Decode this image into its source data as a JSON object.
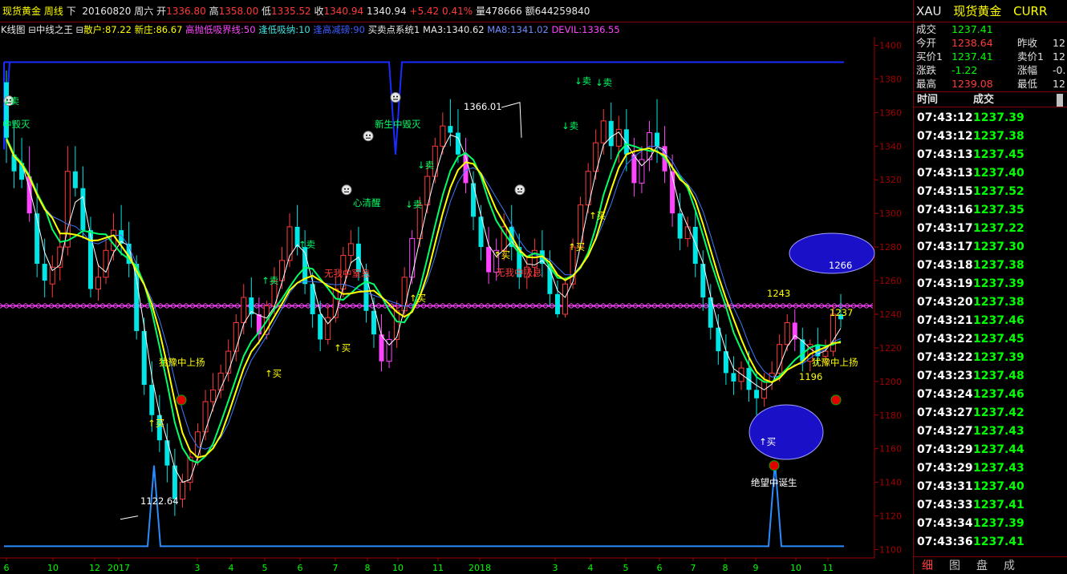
{
  "header": {
    "instrument": "现货黄金",
    "period": "周线",
    "direction": "下",
    "date": "20160820",
    "weekday": "周六",
    "open_label": "开",
    "open": "1336.80",
    "high_label": "高",
    "high": "1358.00",
    "low_label": "低",
    "low": "1335.52",
    "close_label": "收",
    "close": "1340.94",
    "last": "1340.94",
    "change": "+5.42",
    "change_pct": "0.41%",
    "volume_label": "量",
    "volume": "478666",
    "amount_label": "额",
    "amount": "644259840"
  },
  "indicator_bar": {
    "chart_mode": "K线图",
    "ind1": "中线之王",
    "sanhu": "散户:87.22",
    "xinzhuang": "新庄:86.67",
    "gaopao": "高抛低吸界线:50",
    "fengdi": "逢低吸纳:10",
    "fenggao": "逢高减磅:90",
    "ind2": "买卖点系统1",
    "ma3": "MA3:1340.62",
    "ma8": "MA8:1341.02",
    "devil": "DEVIL:1336.55"
  },
  "right_panel": {
    "symbol": "XAU",
    "name": "现货黄金",
    "market": "CURR",
    "quotes": [
      {
        "label": "成交",
        "value": "1237.41",
        "color": "#00ff00"
      },
      {
        "label": "今开",
        "value": "1238.64",
        "color": "#ff3b3b"
      },
      {
        "label": "买价1",
        "value": "1237.41",
        "color": "#00ff00"
      },
      {
        "label": "涨跌",
        "value": "-1.22",
        "color": "#00ff00"
      },
      {
        "label": "最高",
        "value": "1239.08",
        "color": "#ff3b3b"
      }
    ],
    "quotes_right": [
      {
        "label": "昨收",
        "value": "12"
      },
      {
        "label": "卖价1",
        "value": "12"
      },
      {
        "label": "涨幅",
        "value": "-0."
      },
      {
        "label": "最低",
        "value": "12"
      }
    ],
    "trade_header_time": "时间",
    "trade_header_price": "成交",
    "trades": [
      {
        "time": "07:43:12",
        "price": "1237.39"
      },
      {
        "time": "07:43:12",
        "price": "1237.38"
      },
      {
        "time": "07:43:13",
        "price": "1237.45"
      },
      {
        "time": "07:43:13",
        "price": "1237.40"
      },
      {
        "time": "07:43:15",
        "price": "1237.52"
      },
      {
        "time": "07:43:16",
        "price": "1237.35"
      },
      {
        "time": "07:43:17",
        "price": "1237.22"
      },
      {
        "time": "07:43:17",
        "price": "1237.30"
      },
      {
        "time": "07:43:18",
        "price": "1237.38"
      },
      {
        "time": "07:43:19",
        "price": "1237.39"
      },
      {
        "time": "07:43:20",
        "price": "1237.38"
      },
      {
        "time": "07:43:21",
        "price": "1237.46"
      },
      {
        "time": "07:43:22",
        "price": "1237.45"
      },
      {
        "time": "07:43:22",
        "price": "1237.39"
      },
      {
        "time": "07:43:23",
        "price": "1237.48"
      },
      {
        "time": "07:43:24",
        "price": "1237.46"
      },
      {
        "time": "07:43:27",
        "price": "1237.42"
      },
      {
        "time": "07:43:27",
        "price": "1237.43"
      },
      {
        "time": "07:43:29",
        "price": "1237.44"
      },
      {
        "time": "07:43:29",
        "price": "1237.43"
      },
      {
        "time": "07:43:31",
        "price": "1237.40"
      },
      {
        "time": "07:43:33",
        "price": "1237.41"
      },
      {
        "time": "07:43:34",
        "price": "1237.39"
      },
      {
        "time": "07:43:36",
        "price": "1237.41"
      }
    ],
    "tabs": [
      "细",
      "图",
      "盘",
      "成"
    ]
  },
  "chart_data": {
    "type": "candlestick",
    "ylim": [
      1095,
      1405
    ],
    "y_ticks": [
      1100,
      1120,
      1140,
      1160,
      1180,
      1200,
      1220,
      1240,
      1260,
      1280,
      1300,
      1320,
      1340,
      1360,
      1380,
      1400
    ],
    "x_ticks": [
      "6",
      "10",
      "12",
      "2017",
      "3",
      "4",
      "5",
      "6",
      "7",
      "8",
      "10",
      "11",
      "2018",
      "3",
      "4",
      "5",
      "6",
      "7",
      "8",
      "9",
      "10",
      "11"
    ],
    "reference_line": 1245,
    "colors": {
      "up": "#ff3b3b",
      "down": "#00e5e5",
      "special_down": "#ff44ff",
      "yellow": "#ffff00",
      "green": "#00ff66",
      "ma_white": "#ffffff",
      "ma_blue": "#3b7bff",
      "step": "#1a2cff",
      "bottom": "#2a8cff",
      "ref": "#ff44ff"
    },
    "key_prices": [
      {
        "text": "1122.64",
        "price": 1122.64
      },
      {
        "text": "1366.01",
        "price": 1366.01
      },
      {
        "text": "1243",
        "price": 1243
      },
      {
        "text": "1196",
        "price": 1196
      },
      {
        "text": "1237",
        "price": 1237
      },
      {
        "text": "1266",
        "price": 1266
      }
    ],
    "signals": [
      {
        "text": "↓卖"
      },
      {
        "text": "中毁灭"
      },
      {
        "text": "↑买"
      },
      {
        "text": "犹豫中上扬"
      },
      {
        "text": "↑买"
      },
      {
        "text": "↑卖"
      },
      {
        "text": "无我中窒息"
      },
      {
        "text": "↑买"
      },
      {
        "text": "↑卖"
      },
      {
        "text": "心清醒"
      },
      {
        "text": "↓卖"
      },
      {
        "text": "新生中毁灭"
      },
      {
        "text": "↓卖"
      },
      {
        "text": "↑买"
      },
      {
        "text": "无我中吸息"
      },
      {
        "text": "↑买"
      },
      {
        "text": "↓卖"
      },
      {
        "text": "↓卖"
      },
      {
        "text": "↓卖"
      },
      {
        "text": "↑买"
      },
      {
        "text": "↑买"
      },
      {
        "text": "↑买"
      },
      {
        "text": "绝望中诞生"
      },
      {
        "text": "犹豫中上扬"
      }
    ],
    "candles": [
      [
        1378,
        1385,
        1345,
        1330
      ],
      [
        1335,
        1355,
        1325,
        1315
      ],
      [
        1330,
        1345,
        1320,
        1315
      ],
      [
        1322,
        1340,
        1300,
        1295
      ],
      [
        1300,
        1318,
        1270,
        1262
      ],
      [
        1270,
        1285,
        1260,
        1250
      ],
      [
        1258,
        1275,
        1268,
        1250
      ],
      [
        1268,
        1290,
        1280,
        1260
      ],
      [
        1280,
        1340,
        1325,
        1275
      ],
      [
        1325,
        1340,
        1315,
        1310
      ],
      [
        1315,
        1328,
        1290,
        1285
      ],
      [
        1290,
        1298,
        1255,
        1250
      ],
      [
        1255,
        1270,
        1262,
        1248
      ],
      [
        1262,
        1285,
        1278,
        1258
      ],
      [
        1278,
        1300,
        1290,
        1272
      ],
      [
        1290,
        1305,
        1282,
        1275
      ],
      [
        1282,
        1295,
        1270,
        1262
      ],
      [
        1270,
        1275,
        1230,
        1225
      ],
      [
        1230,
        1238,
        1198,
        1192
      ],
      [
        1198,
        1212,
        1180,
        1170
      ],
      [
        1180,
        1192,
        1165,
        1158
      ],
      [
        1165,
        1175,
        1150,
        1140
      ],
      [
        1150,
        1160,
        1130,
        1120
      ],
      [
        1130,
        1145,
        1140,
        1125
      ],
      [
        1140,
        1160,
        1155,
        1135
      ],
      [
        1155,
        1175,
        1170,
        1150
      ],
      [
        1170,
        1195,
        1188,
        1165
      ],
      [
        1188,
        1205,
        1195,
        1182
      ],
      [
        1195,
        1210,
        1205,
        1190
      ],
      [
        1205,
        1225,
        1218,
        1200
      ],
      [
        1218,
        1240,
        1235,
        1212
      ],
      [
        1235,
        1258,
        1250,
        1228
      ],
      [
        1250,
        1262,
        1240,
        1232
      ],
      [
        1240,
        1250,
        1228,
        1222
      ],
      [
        1228,
        1248,
        1245,
        1225
      ],
      [
        1245,
        1268,
        1260,
        1240
      ],
      [
        1260,
        1280,
        1272,
        1255
      ],
      [
        1272,
        1300,
        1292,
        1268
      ],
      [
        1292,
        1305,
        1280,
        1275
      ],
      [
        1280,
        1290,
        1258,
        1252
      ],
      [
        1258,
        1265,
        1240,
        1232
      ],
      [
        1240,
        1248,
        1225,
        1218
      ],
      [
        1225,
        1245,
        1238,
        1222
      ],
      [
        1238,
        1262,
        1255,
        1235
      ],
      [
        1255,
        1280,
        1275,
        1250
      ],
      [
        1275,
        1290,
        1282,
        1270
      ],
      [
        1282,
        1292,
        1265,
        1260
      ],
      [
        1265,
        1270,
        1242,
        1235
      ],
      [
        1242,
        1250,
        1228,
        1220
      ],
      [
        1228,
        1240,
        1212,
        1206
      ],
      [
        1212,
        1230,
        1225,
        1208
      ],
      [
        1225,
        1248,
        1242,
        1220
      ],
      [
        1242,
        1268,
        1262,
        1238
      ],
      [
        1262,
        1290,
        1285,
        1258
      ],
      [
        1285,
        1310,
        1305,
        1280
      ],
      [
        1305,
        1330,
        1322,
        1300
      ],
      [
        1322,
        1345,
        1340,
        1318
      ],
      [
        1340,
        1360,
        1352,
        1335
      ],
      [
        1352,
        1368,
        1348,
        1340
      ],
      [
        1348,
        1362,
        1335,
        1330
      ],
      [
        1335,
        1345,
        1318,
        1312
      ],
      [
        1318,
        1325,
        1298,
        1290
      ],
      [
        1298,
        1305,
        1280,
        1272
      ],
      [
        1280,
        1292,
        1265,
        1258
      ],
      [
        1265,
        1285,
        1278,
        1260
      ],
      [
        1278,
        1300,
        1292,
        1272
      ],
      [
        1292,
        1305,
        1280,
        1272
      ],
      [
        1280,
        1288,
        1262,
        1255
      ],
      [
        1262,
        1275,
        1268,
        1255
      ],
      [
        1268,
        1285,
        1278,
        1262
      ],
      [
        1278,
        1290,
        1270,
        1262
      ],
      [
        1270,
        1278,
        1252,
        1245
      ],
      [
        1252,
        1260,
        1240,
        1238
      ],
      [
        1240,
        1262,
        1258,
        1238
      ],
      [
        1258,
        1285,
        1280,
        1255
      ],
      [
        1280,
        1310,
        1305,
        1278
      ],
      [
        1305,
        1330,
        1325,
        1300
      ],
      [
        1325,
        1350,
        1342,
        1320
      ],
      [
        1342,
        1362,
        1355,
        1335
      ],
      [
        1355,
        1366,
        1340,
        1332
      ],
      [
        1340,
        1358,
        1350,
        1330
      ],
      [
        1350,
        1362,
        1335,
        1325
      ],
      [
        1335,
        1345,
        1318,
        1310
      ],
      [
        1318,
        1340,
        1332,
        1312
      ],
      [
        1332,
        1355,
        1348,
        1325
      ],
      [
        1348,
        1368,
        1340,
        1330
      ],
      [
        1340,
        1352,
        1325,
        1318
      ],
      [
        1325,
        1335,
        1300,
        1292
      ],
      [
        1300,
        1312,
        1285,
        1278
      ],
      [
        1285,
        1298,
        1292,
        1280
      ],
      [
        1292,
        1302,
        1270,
        1262
      ],
      [
        1270,
        1278,
        1250,
        1242
      ],
      [
        1250,
        1258,
        1232,
        1225
      ],
      [
        1232,
        1240,
        1218,
        1210
      ],
      [
        1218,
        1228,
        1205,
        1198
      ],
      [
        1205,
        1215,
        1200,
        1192
      ],
      [
        1200,
        1212,
        1208,
        1195
      ],
      [
        1208,
        1218,
        1195,
        1188
      ],
      [
        1195,
        1205,
        1190,
        1180
      ],
      [
        1190,
        1205,
        1200,
        1185
      ],
      [
        1200,
        1212,
        1205,
        1195
      ],
      [
        1205,
        1228,
        1222,
        1200
      ],
      [
        1222,
        1240,
        1235,
        1218
      ],
      [
        1235,
        1243,
        1225,
        1218
      ],
      [
        1225,
        1232,
        1212,
        1206
      ],
      [
        1212,
        1225,
        1222,
        1206
      ],
      [
        1222,
        1232,
        1215,
        1210
      ],
      [
        1215,
        1225,
        1218,
        1210
      ],
      [
        1218,
        1245,
        1240,
        1215
      ],
      [
        1240,
        1252,
        1237,
        1232
      ]
    ]
  }
}
